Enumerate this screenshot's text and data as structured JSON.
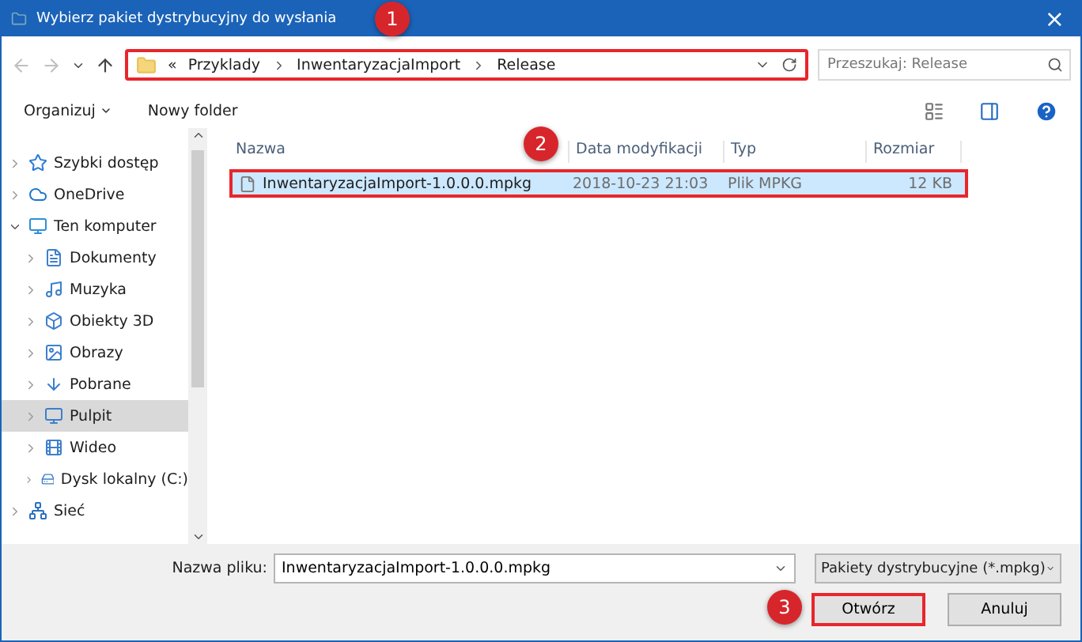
{
  "window": {
    "title": "Wybierz pakiet dystrybucyjny do wysłania",
    "close": "×"
  },
  "callouts": [
    {
      "number": "1"
    },
    {
      "number": "2"
    },
    {
      "number": "3"
    }
  ],
  "address_bar": {
    "prefix": "«",
    "crumbs": [
      "Przyklady",
      "InwentaryzacjaImport",
      "Release"
    ],
    "annotated": true
  },
  "search": {
    "placeholder": "Przeszukaj: Release"
  },
  "toolbar": {
    "organize": "Organizuj",
    "new_folder": "Nowy folder"
  },
  "sidebar": {
    "items": [
      {
        "label": "Szybki dostęp",
        "expanded": false,
        "selected": false
      },
      {
        "label": "OneDrive",
        "expanded": false,
        "selected": false
      },
      {
        "label": "Ten komputer",
        "expanded": true,
        "selected": false,
        "children": [
          {
            "label": "Dokumenty",
            "expanded": false,
            "selected": false
          },
          {
            "label": "Muzyka",
            "expanded": false,
            "selected": false
          },
          {
            "label": "Obiekty 3D",
            "expanded": false,
            "selected": false
          },
          {
            "label": "Obrazy",
            "expanded": false,
            "selected": false
          },
          {
            "label": "Pobrane",
            "expanded": false,
            "selected": false
          },
          {
            "label": "Pulpit",
            "expanded": false,
            "selected": true
          },
          {
            "label": "Wideo",
            "expanded": false,
            "selected": false
          },
          {
            "label": "Dysk lokalny (C:)",
            "expanded": false,
            "selected": false
          }
        ]
      },
      {
        "label": "Sieć",
        "expanded": false,
        "selected": false
      }
    ]
  },
  "table": {
    "columns": [
      "Nazwa",
      "Data modyfikacji",
      "Typ",
      "Rozmiar"
    ],
    "rows": [
      {
        "name": "InwentaryzacjaImport-1.0.0.0.mpkg",
        "date": "2018-10-23 21:03",
        "type": "Plik MPKG",
        "size": "12 KB",
        "selected": true,
        "annotated": true
      }
    ]
  },
  "footer": {
    "filename_label": "Nazwa pliku:",
    "filename": "InwentaryzacjaImport-1.0.0.0.mpkg",
    "filter": "Pakiety dystrybucyjne (*.mpkg)",
    "open": "Otwórz",
    "cancel": "Anuluj",
    "open_annotated": true
  }
}
